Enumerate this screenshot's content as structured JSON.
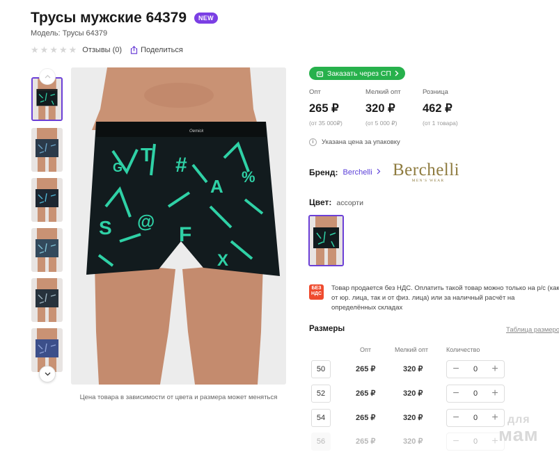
{
  "product": {
    "title": "Трусы мужские 64379",
    "badge": "NEW",
    "model": "Модель: Трусы 64379",
    "reviews": "Отзывы (0)",
    "share": "Поделиться",
    "rating": 0
  },
  "gallery": {
    "caption": "Цена товара в зависимости от цвета и размера может меняться",
    "thumb_count": 6
  },
  "order_button": "Заказать через СП",
  "prices": [
    {
      "label": "Опт",
      "value": "265 ₽",
      "note": "(от 35 000₽)"
    },
    {
      "label": "Мелкий опт",
      "value": "320 ₽",
      "note": "(от 5 000 ₽)"
    },
    {
      "label": "Розница",
      "value": "462 ₽",
      "note": "(от 1 товара)"
    }
  ],
  "pack_note": "Указана цена за упаковку",
  "brand": {
    "label": "Бренд:",
    "name": "Berchelli",
    "logo_word": "Berchelli",
    "logo_sub": "MEN'S WEAR"
  },
  "color": {
    "label": "Цвет:",
    "value": "ассорти"
  },
  "vat": {
    "badge_line1": "БЕЗ",
    "badge_line2": "НДС",
    "text": "Товар продается без НДС. Оплатить такой товар можно только на р/с (как от юр. лица, так и от физ. лица) или за наличный расчёт на определённых складах"
  },
  "sizes": {
    "title": "Размеры",
    "table_link": "Таблица размеров",
    "headers": {
      "opt": "Опт",
      "small_opt": "Мелкий опт",
      "qty": "Количество"
    },
    "rows": [
      {
        "size": "50",
        "opt": "265 ₽",
        "small_opt": "320 ₽",
        "qty": "0",
        "available": true
      },
      {
        "size": "52",
        "opt": "265 ₽",
        "small_opt": "320 ₽",
        "qty": "0",
        "available": true
      },
      {
        "size": "54",
        "opt": "265 ₽",
        "small_opt": "320 ₽",
        "qty": "0",
        "available": true
      },
      {
        "size": "56",
        "opt": "265 ₽",
        "small_opt": "320 ₽",
        "qty": "0",
        "available": false
      }
    ]
  },
  "watermark": {
    "line1": "для",
    "line2": "мам"
  },
  "colors": {
    "accent": "#7b3fe4",
    "green": "#27b14c",
    "print": "#2fd1a6",
    "fabric": "#121b1e",
    "skin": "#c99274"
  }
}
